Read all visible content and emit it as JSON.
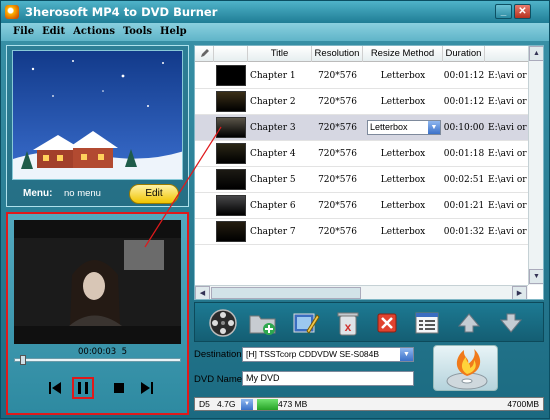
{
  "window": {
    "title": "3herosoft MP4 to DVD Burner"
  },
  "menu_bar": [
    "File",
    "Edit",
    "Actions",
    "Tools",
    "Help"
  ],
  "preview": {
    "menu_label": "Menu:",
    "menu_value": "no menu",
    "edit_label": "Edit"
  },
  "player": {
    "time": "00:00:03",
    "time_suffix": "5",
    "progress": 0.03
  },
  "list": {
    "columns": [
      "Title",
      "Resolution",
      "Resize Method",
      "Duration"
    ],
    "rows": [
      {
        "title": "Chapter 1",
        "resolution": "720*576",
        "resize": "Letterbox",
        "duration": "00:01:12",
        "path": "E:\\avi or mpeg"
      },
      {
        "title": "Chapter 2",
        "resolution": "720*576",
        "resize": "Letterbox",
        "duration": "00:01:12",
        "path": "E:\\avi or mpeg"
      },
      {
        "title": "Chapter 3",
        "resolution": "720*576",
        "resize": "Letterbox",
        "duration": "00:10:00",
        "path": "E:\\avi or mpeg"
      },
      {
        "title": "Chapter 4",
        "resolution": "720*576",
        "resize": "Letterbox",
        "duration": "00:01:18",
        "path": "E:\\avi or mpeg"
      },
      {
        "title": "Chapter 5",
        "resolution": "720*576",
        "resize": "Letterbox",
        "duration": "00:02:51",
        "path": "E:\\avi or mpeg"
      },
      {
        "title": "Chapter 6",
        "resolution": "720*576",
        "resize": "Letterbox",
        "duration": "00:01:21",
        "path": "E:\\avi or mpeg"
      },
      {
        "title": "Chapter 7",
        "resolution": "720*576",
        "resize": "Letterbox",
        "duration": "00:01:32",
        "path": "E:\\avi or mpeg"
      }
    ],
    "selected_row": 2
  },
  "output": {
    "destination_label": "Destination:",
    "destination_value": "[H] TSSTcorp CDDVDW SE-S084B",
    "dvd_name_label": "DVD Name:",
    "dvd_name_value": "My DVD",
    "disc_type": "D5",
    "disc_size": "4.7G",
    "used": "473 MB",
    "max": "4700MB",
    "used_fraction": 0.1
  },
  "colors": {
    "accent": "#1d7a93",
    "highlight": "#e0191b",
    "edit_button": "#f0c400"
  }
}
